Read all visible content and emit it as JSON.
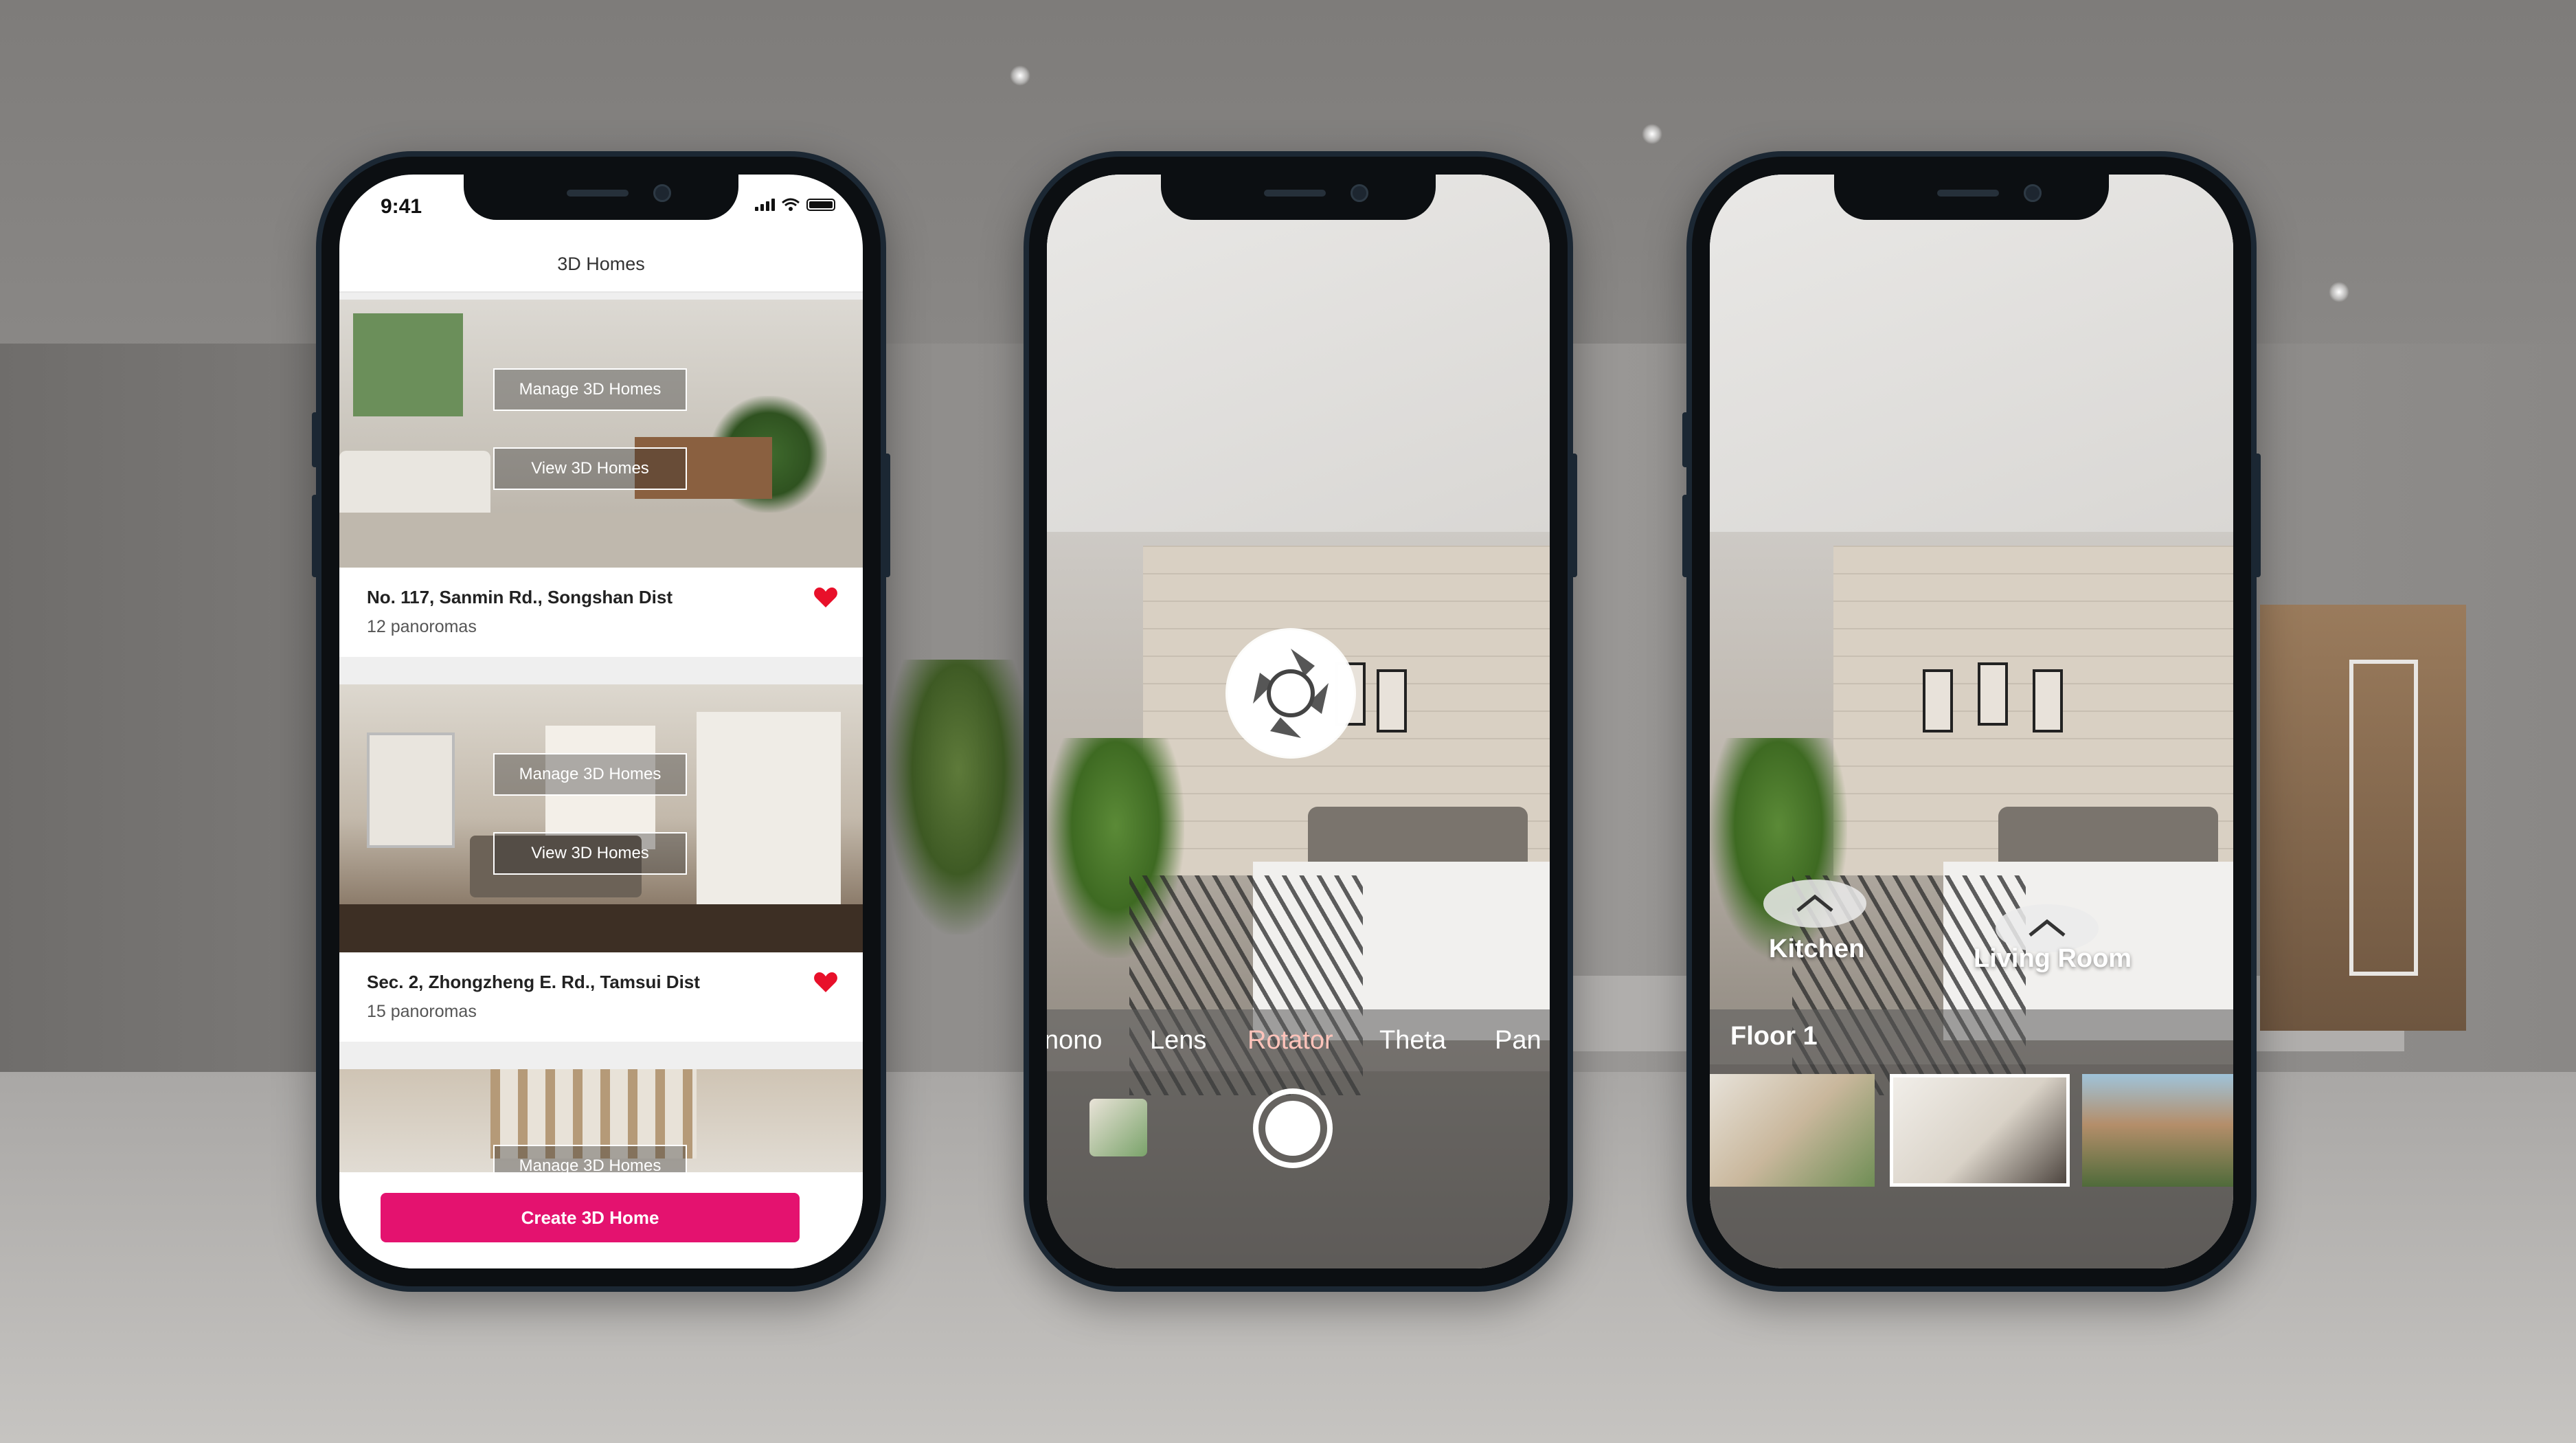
{
  "colors": {
    "accent": "#e4126f",
    "heart": "#e8102a",
    "active_mode": "#ffc3ba"
  },
  "phone1": {
    "status": {
      "time": "9:41"
    },
    "nav": {
      "title": "3D Homes"
    },
    "cards": [
      {
        "address": "No. 117, Sanmin Rd., Songshan Dist",
        "panoramas": "12 panoromas",
        "manage_label": "Manage 3D Homes",
        "view_label": "View 3D Homes",
        "favorited": true
      },
      {
        "address": "Sec. 2, Zhongzheng E. Rd., Tamsui Dist",
        "panoramas": "15 panoromas",
        "manage_label": "Manage 3D Homes",
        "view_label": "View 3D Homes",
        "favorited": true
      },
      {
        "manage_label": "Manage 3D Homes"
      }
    ],
    "create_button": "Create 3D Home"
  },
  "phone2": {
    "modes": [
      "nono",
      "Lens",
      "Rotator",
      "Theta",
      "Pan"
    ],
    "active_mode": "Rotator"
  },
  "phone3": {
    "hotspots": [
      {
        "label": "Kitchen",
        "icon": "chevron-up-icon"
      },
      {
        "label": "Living Room",
        "icon": "chevron-up-icon"
      }
    ],
    "floor_label": "Floor 1",
    "selected_thumb": 1
  }
}
